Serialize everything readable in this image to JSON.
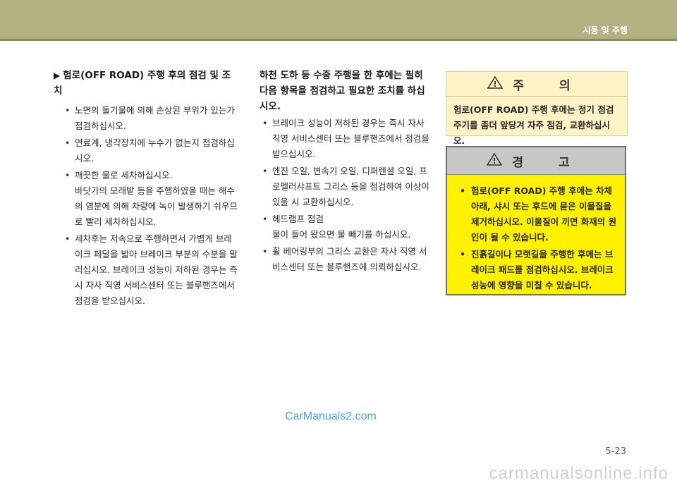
{
  "header": {
    "section": "시동 및 주행"
  },
  "left": {
    "heading": "험로(OFF ROAD) 주행 후의 점검 및 조치",
    "items": [
      {
        "text": "노면의 돌기물에 의해 손상된 부위가 있는가 점검하십시오."
      },
      {
        "text": "연료계, 냉각장치에 누수가 없는지 점검하십시오."
      },
      {
        "text": "깨끗한 물로 세차하십시오.",
        "sub": "바닷가의 모래밭 등을 주행하였을 때는 해수의 염분에 의해 차량에 녹이 발생하기 쉬우므로 빨리 세차하십시오."
      },
      {
        "text": "세차후는 저속으로 주행하면서 가볍게 브레이크 페달을 밟아 브레이크 부분의 수분을 말리십시오. 브레이크 성능이 저하된 경우는 즉시 자사 직영 서비스센터 또는 블루핸즈에서 점검을 받으십시오."
      }
    ]
  },
  "middle": {
    "heading": "하천 도하 등 수중 주행을 한 후에는 필히 다음 항목을 점검하고 필요한 조치를 하십시오.",
    "items": [
      {
        "text": "브레이크 성능이 저하된 경우는 즉시 자사 직영 서비스센터 또는 블루핸즈에서 점검을 받으십시오."
      },
      {
        "text": "엔진 오일, 변속기 오일, 디퍼렌셜 오일, 프로펠러샤프트 그리스 등을 점검하여 이상이 있을 시 교환하십시오."
      },
      {
        "text": "헤드램프 점검",
        "sub": "물이 들어 왔으면 물 빼기를 하십시오."
      },
      {
        "text": "휠 베어링부의 그리스 교환은 자사 직영 서비스센터 또는 블루핸즈에 의뢰하십시오."
      }
    ]
  },
  "caution": {
    "title": "주 의",
    "body": "험로(OFF ROAD) 주행 후에는 정기 점검 주기를 좀더 앞당겨 자주 점검, 교환하십시오."
  },
  "warning": {
    "title": "경 고",
    "items": [
      "험로(OFF ROAD) 주행 후에는 차체 아래, 샤시 또는 후드에 묻은 이물질을 제거하십시오. 이물질이 끼면 화재의 원인이 될 수 있습니다.",
      "진흙길이나 모랫길을 주행한 후에는 브레이크 패드를 점검하십시오. 브레이크 성능에 영향을 미칠 수 있습니다."
    ]
  },
  "watermark": "CarManuals2.com",
  "page_number": "5-23",
  "footer_watermark": "carmanualsonline.info"
}
